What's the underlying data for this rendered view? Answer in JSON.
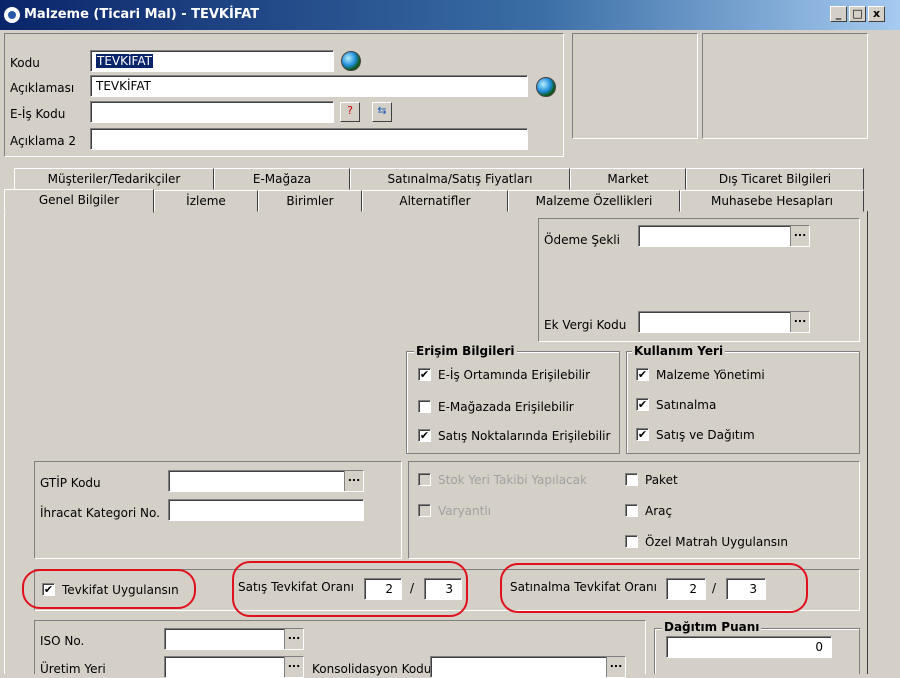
{
  "window": {
    "title": "Malzeme (Ticari Mal) - TEVKİFAT",
    "minimize": "_",
    "maximize": "□",
    "close": "x"
  },
  "header": {
    "kodu_label": "Kodu",
    "kodu_value": "TEVKİFAT",
    "aciklamasi_label": "Açıklaması",
    "aciklamasi_value": "TEVKİFAT",
    "eis_label": "E-İş Kodu",
    "eis_value": "",
    "aciklama2_label": "Açıklama 2",
    "aciklama2_value": ""
  },
  "tabs_row1": [
    "Müşteriler/Tedarikçiler",
    "E-Mağaza",
    "Satınalma/Satış Fiyatları",
    "Market",
    "Dış Ticaret Bilgileri"
  ],
  "tabs_row2": [
    "Genel Bilgiler",
    "İzleme",
    "Birimler",
    "Alternatifler",
    "Malzeme Özellikleri",
    "Muhasebe Hesapları"
  ],
  "payment": {
    "odeme_label": "Ödeme Şekli",
    "odeme_value": "",
    "ekvergi_label": "Ek Vergi Kodu",
    "ekvergi_value": ""
  },
  "erisim": {
    "title": "Erişim Bilgileri",
    "items": [
      {
        "label": "E-İş Ortamında Erişilebilir",
        "checked": true
      },
      {
        "label": "E-Mağazada Erişilebilir",
        "checked": false
      },
      {
        "label": "Satış Noktalarında Erişilebilir",
        "checked": true
      }
    ]
  },
  "kullanim": {
    "title": "Kullanım Yeri",
    "items": [
      {
        "label": "Malzeme Yönetimi",
        "checked": true
      },
      {
        "label": "Satınalma",
        "checked": true
      },
      {
        "label": "Satış ve Dağıtım",
        "checked": true
      }
    ]
  },
  "customs": {
    "gtip_label": "GTİP Kodu",
    "gtip_value": "",
    "ihracat_label": "İhracat Kategori No.",
    "ihracat_value": ""
  },
  "options": {
    "stok": "Stok Yeri Takibi Yapılacak",
    "varyant": "Varyantlı",
    "paket": "Paket",
    "arac": "Araç",
    "ozel": "Özel Matrah Uygulansın"
  },
  "tevkifat": {
    "uygula_label": "Tevkifat Uygulansın",
    "uygula_checked": true,
    "satis_label": "Satış Tevkifat Oranı",
    "satis_num": "2",
    "satis_den": "3",
    "satinalma_label": "Satınalma Tevkifat Oranı",
    "satinalma_num": "2",
    "satinalma_den": "3",
    "slash": "/"
  },
  "bottom": {
    "iso_label": "ISO No.",
    "iso_value": "",
    "uretim_label": "Üretim Yeri",
    "uretim_value": "",
    "konsol_label": "Konsolidasyon Kodu",
    "konsol_value": "",
    "dagitim_title": "Dağıtım Puanı",
    "dagitim_value": "0"
  },
  "check_mark": "✔",
  "dots_label": "..."
}
